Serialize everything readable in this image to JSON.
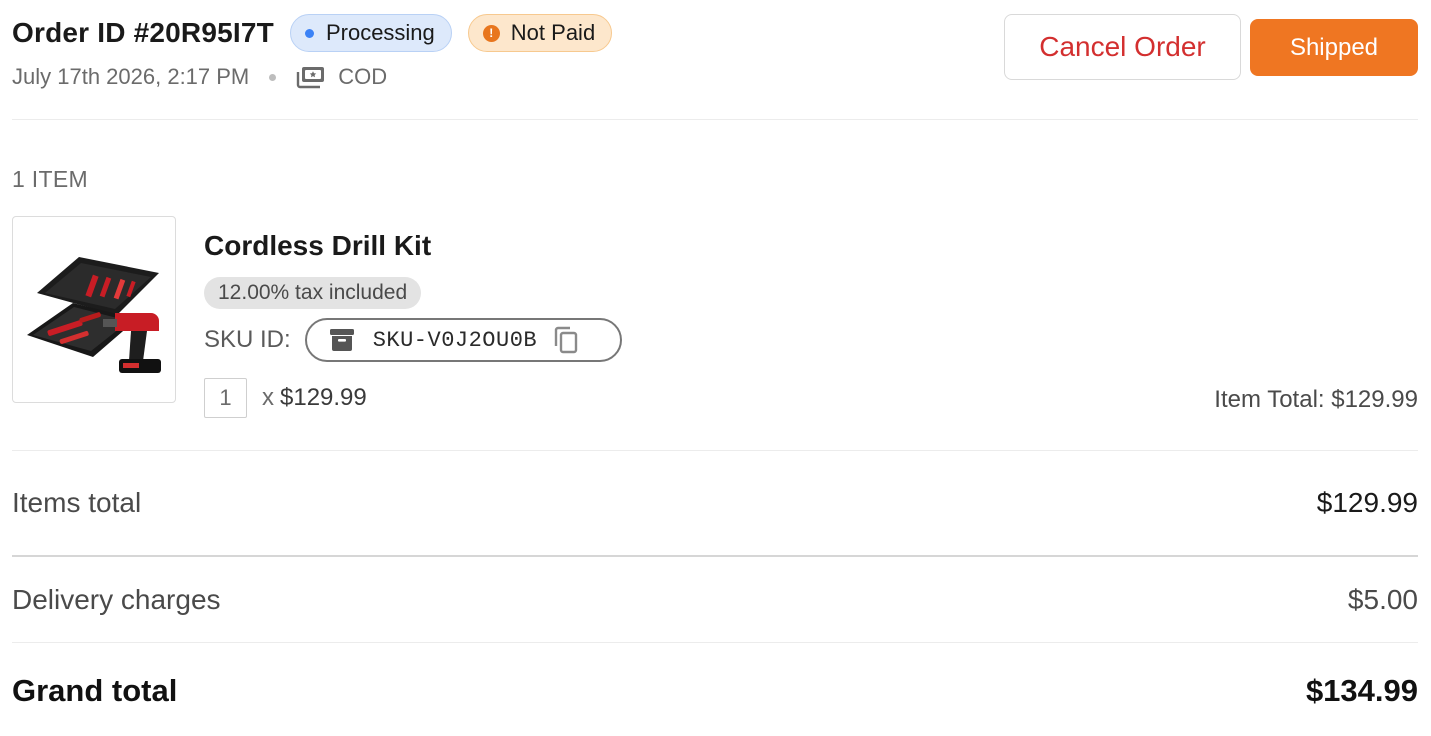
{
  "order": {
    "id_label": "Order ID #20R95I7T",
    "status_badge": "Processing",
    "payment_badge": "Not Paid",
    "payment_badge_icon": "!",
    "date": "July 17th 2026, 2:17 PM",
    "payment_method": "COD"
  },
  "actions": {
    "cancel_label": "Cancel Order",
    "shipped_label": "Shipped"
  },
  "items": {
    "count_label": "1 ITEM",
    "list": [
      {
        "name": "Cordless Drill Kit",
        "tax_note": "12.00% tax included",
        "sku_label": "SKU ID:",
        "sku": "SKU-V0J2OU0B",
        "quantity": "1",
        "unit_price": "$129.99",
        "multiplier": "x",
        "item_total": "Item Total: $129.99"
      }
    ]
  },
  "summary": {
    "items_total_label": "Items total",
    "items_total_value": "$129.99",
    "delivery_label": "Delivery charges",
    "delivery_value": "$5.00",
    "grand_total_label": "Grand total",
    "grand_total_value": "$134.99"
  },
  "colors": {
    "accent": "#ef7622",
    "danger": "#d32f2f",
    "processing_dot": "#3b82f6",
    "not_paid_icon": "#e8761e"
  }
}
